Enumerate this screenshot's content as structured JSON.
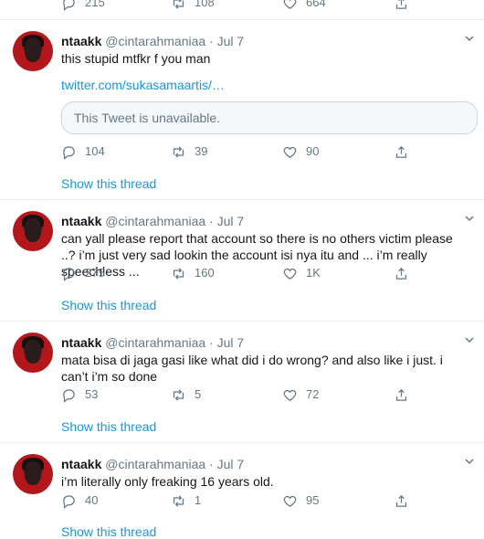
{
  "top_actions": {
    "reply": "215",
    "retweet": "108",
    "like": "664"
  },
  "tweets": [
    {
      "name": "ntaakk",
      "handle": "@cintarahmaniaa",
      "dot": "·",
      "date": "Jul 7",
      "text": "this stupid mtfkr f you man",
      "link": "twitter.com/sukasamaartis/…",
      "quote": "This Tweet is unavailable.",
      "reply": "104",
      "retweet": "39",
      "like": "90",
      "show_thread": "Show this thread"
    },
    {
      "name": "ntaakk",
      "handle": "@cintarahmaniaa",
      "dot": "·",
      "date": "Jul 7",
      "text": "can yall please report that account so there is no others victim please ..? i’m just very sad lookin the account isi nya itu and ... i’m really speechless ...",
      "reply": "275",
      "retweet": "160",
      "like": "1K",
      "show_thread": "Show this thread"
    },
    {
      "name": "ntaakk",
      "handle": "@cintarahmaniaa",
      "dot": "·",
      "date": "Jul 7",
      "text": "mata bisa di jaga gasi like what did i do wrong? and also like i just. i can’t i’m so done",
      "reply": "53",
      "retweet": "5",
      "like": "72",
      "show_thread": "Show this thread"
    },
    {
      "name": "ntaakk",
      "handle": "@cintarahmaniaa",
      "dot": "·",
      "date": "Jul 7",
      "text": "i’m literally only freaking 16 years old.",
      "reply": "40",
      "retweet": "1",
      "like": "95",
      "show_thread": "Show this thread"
    }
  ]
}
